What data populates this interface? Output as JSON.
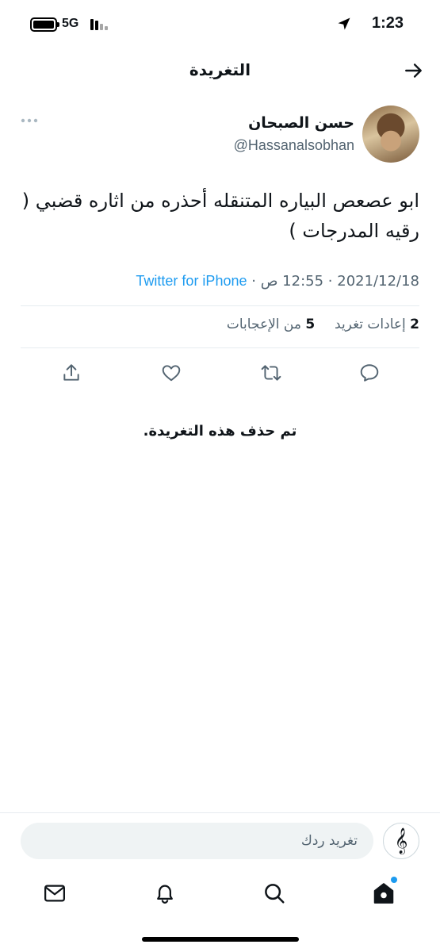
{
  "status_bar": {
    "time": "1:23",
    "network": "5G",
    "location_icon": "location-arrow-icon",
    "battery_icon": "battery-icon",
    "signal_icon": "signal-bars-icon"
  },
  "header": {
    "title": "التغريدة",
    "back_icon": "arrow-right-icon"
  },
  "tweet": {
    "author_name": "حسن الصبحان",
    "author_handle": "@Hassanalsobhan",
    "more_icon": "ellipsis-icon",
    "text": "ابو عصعص البياره المتنقله أحذره من اثاره قضبي ( رقيه المدرجات )",
    "date": "2021/12/18",
    "separator": "·",
    "time": "12:55 ص",
    "source": "Twitter for iPhone",
    "retweets_count": "2",
    "retweets_label": "إعادات تغريد",
    "likes_count": "5",
    "likes_label": "من الإعجابات"
  },
  "actions": {
    "reply_icon": "reply-icon",
    "retweet_icon": "retweet-icon",
    "like_icon": "heart-icon",
    "share_icon": "share-icon"
  },
  "deleted_notice": "تم حذف هذه التغريدة.",
  "composer": {
    "placeholder": "تغريد ردك",
    "avatar_glyph": "𝄞"
  },
  "tab_bar": {
    "items": [
      "home-icon",
      "search-icon",
      "bell-icon",
      "mail-icon"
    ]
  },
  "colors": {
    "accent": "#1d9bf0",
    "text": "#0f1419",
    "secondary_text": "#536471",
    "divider": "#e6ecf0"
  }
}
